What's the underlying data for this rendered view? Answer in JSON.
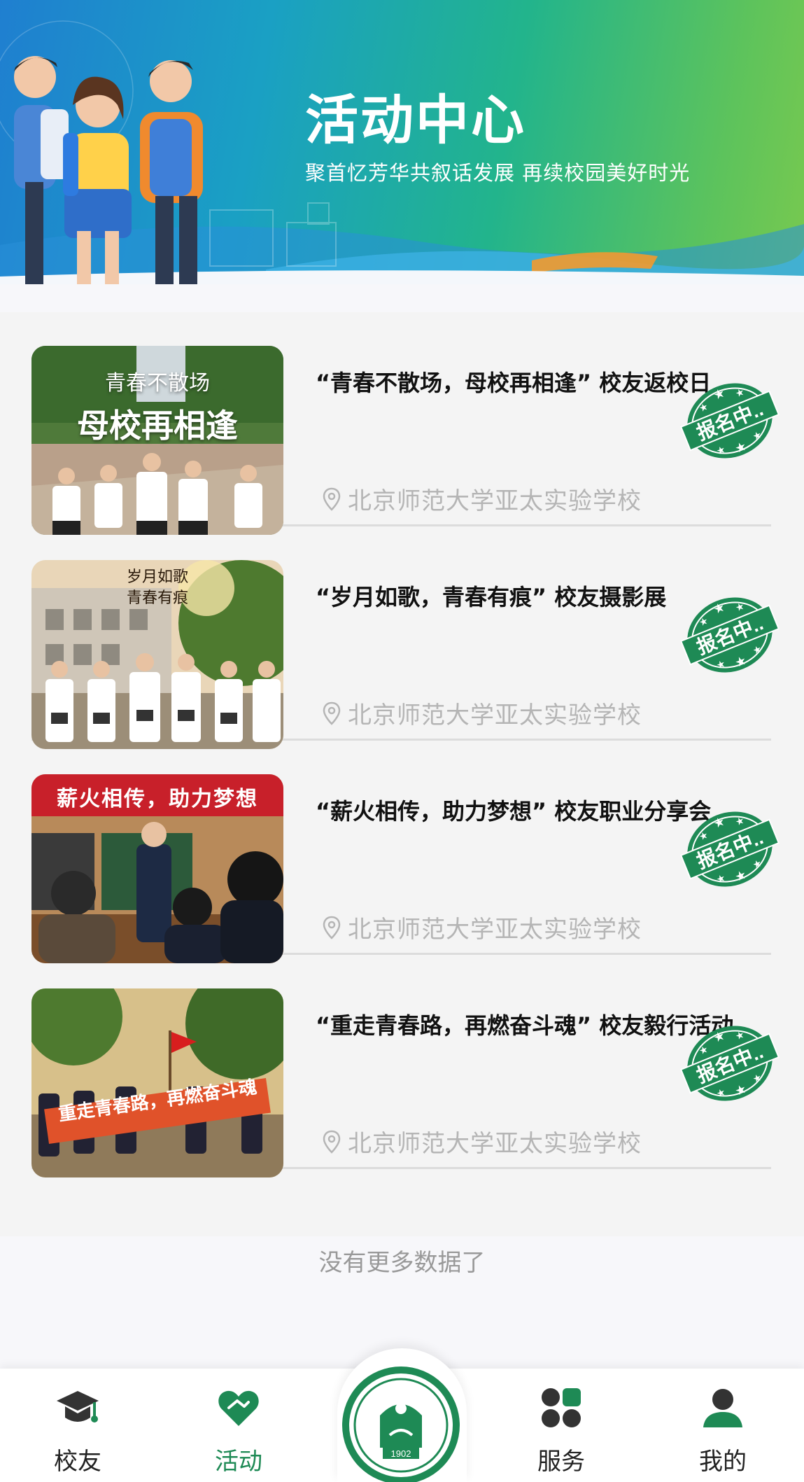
{
  "banner": {
    "title": "活动中心",
    "subtitle": "聚首忆芳华共叙话发展 再续校园美好时光"
  },
  "activities": [
    {
      "title": "“青春不散场，母校再相逢” 校友返校日",
      "location": "北京师范大学亚太实验学校",
      "status": "报名中..",
      "image_text": [
        "青春不散场",
        "母校再相逢"
      ]
    },
    {
      "title": "“岁月如歌，青春有痕” 校友摄影展",
      "location": "北京师范大学亚太实验学校",
      "status": "报名中..",
      "image_text": [
        "岁月如歌",
        "青春有痕"
      ]
    },
    {
      "title": "“薪火相传，助力梦想” 校友职业分享会",
      "location": "北京师范大学亚太实验学校",
      "status": "报名中..",
      "image_text": [
        "薪火相传，助力梦想"
      ]
    },
    {
      "title": "“重走青春路，再燃奋斗魂” 校友毅行活动",
      "location": "北京师范大学亚太实验学校",
      "status": "报名中..",
      "image_text": [
        "重走青春路，再燃奋斗魂"
      ]
    }
  ],
  "footer_text": "没有更多数据了",
  "tabbar": {
    "items": [
      {
        "label": "校友",
        "icon": "graduation-cap-icon"
      },
      {
        "label": "活动",
        "icon": "heart-hands-icon",
        "active": true
      },
      {
        "label": "服务",
        "icon": "clover-icon"
      },
      {
        "label": "我的",
        "icon": "user-icon"
      }
    ],
    "center_logo": "school-emblem",
    "logo_year": "1902"
  },
  "colors": {
    "active": "#1e8a55",
    "stamp": "#1e8a55",
    "text_muted": "#b5b5b5"
  }
}
